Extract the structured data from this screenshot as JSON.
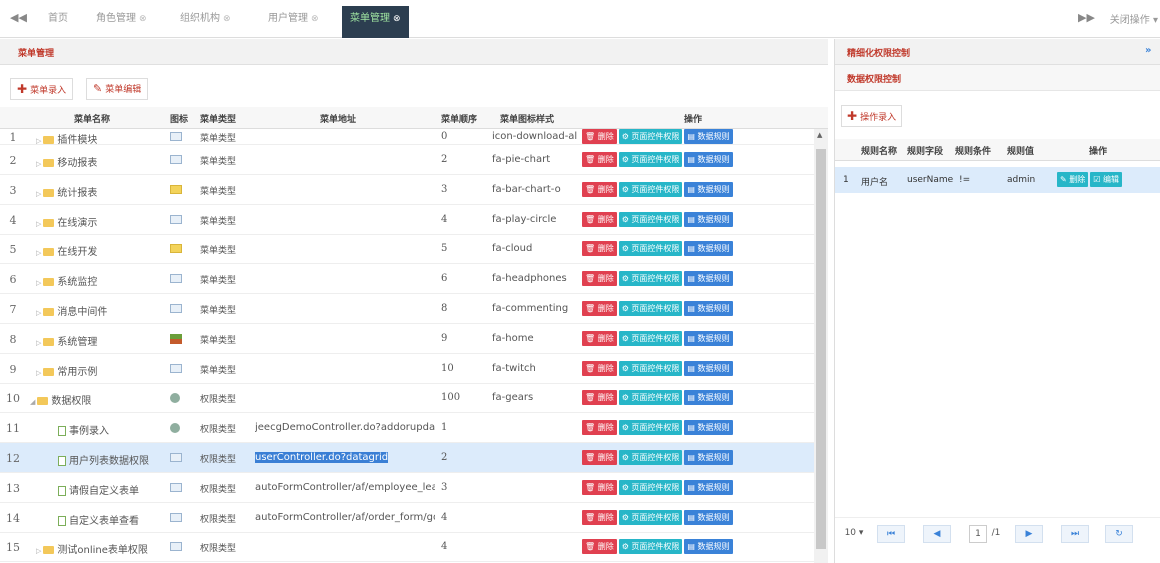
{
  "tabs": {
    "left_arrow": "◀◀",
    "items": [
      {
        "label": "首页",
        "closable": false
      },
      {
        "label": "角色管理",
        "closable": true
      },
      {
        "label": "组织机构",
        "closable": true
      },
      {
        "label": "用户管理",
        "closable": true
      },
      {
        "label": "菜单管理",
        "closable": true,
        "active": true
      }
    ],
    "right_arrow": "▶▶",
    "close_ops": "关闭操作"
  },
  "left_panel": {
    "title": "菜单管理",
    "toolbar": {
      "add_label": "菜单录入",
      "edit_label": "菜单编辑"
    },
    "columns": [
      "菜单名称",
      "图标",
      "菜单类型",
      "菜单地址",
      "菜单顺序",
      "菜单图标样式",
      "操作"
    ],
    "ops": {
      "delete": "删除",
      "page_perm": "页面控件权限",
      "data_rule": "数据规则"
    },
    "rows": [
      {
        "n": "1",
        "name": "插件模块",
        "kind": "folder",
        "icon": "box",
        "type": "菜单类型",
        "url": "",
        "order": "0",
        "style": "icon-download-alt"
      },
      {
        "n": "2",
        "name": "移动报表",
        "kind": "folder",
        "icon": "box",
        "type": "菜单类型",
        "url": "",
        "order": "2",
        "style": "fa-pie-chart"
      },
      {
        "n": "3",
        "name": "统计报表",
        "kind": "folder",
        "icon": "yel",
        "type": "菜单类型",
        "url": "",
        "order": "3",
        "style": "fa-bar-chart-o"
      },
      {
        "n": "4",
        "name": "在线演示",
        "kind": "folder",
        "icon": "box",
        "type": "菜单类型",
        "url": "",
        "order": "4",
        "style": "fa-play-circle"
      },
      {
        "n": "5",
        "name": "在线开发",
        "kind": "folder",
        "icon": "yel",
        "type": "菜单类型",
        "url": "",
        "order": "5",
        "style": "fa-cloud"
      },
      {
        "n": "6",
        "name": "系统监控",
        "kind": "folder",
        "icon": "box",
        "type": "菜单类型",
        "url": "",
        "order": "6",
        "style": "fa-headphones"
      },
      {
        "n": "7",
        "name": "消息中间件",
        "kind": "folder",
        "icon": "box",
        "type": "菜单类型",
        "url": "",
        "order": "8",
        "style": "fa-commenting"
      },
      {
        "n": "8",
        "name": "系统管理",
        "kind": "folder",
        "icon": "house",
        "type": "菜单类型",
        "url": "",
        "order": "9",
        "style": "fa-home"
      },
      {
        "n": "9",
        "name": "常用示例",
        "kind": "folder",
        "icon": "box",
        "type": "菜单类型",
        "url": "",
        "order": "10",
        "style": "fa-twitch"
      },
      {
        "n": "10",
        "name": "数据权限",
        "kind": "folder-open",
        "icon": "gear",
        "type": "权限类型",
        "url": "",
        "order": "100",
        "style": "fa-gears"
      },
      {
        "n": "11",
        "name": "事例录入",
        "kind": "doc",
        "icon": "gear",
        "type": "权限类型",
        "url": "jeecgDemoController.do?addorupdate",
        "order": "1",
        "style": ""
      },
      {
        "n": "12",
        "name": "用户列表数据权限",
        "kind": "doc",
        "icon": "box",
        "type": "权限类型",
        "url": "userController.do?datagrid",
        "order": "2",
        "style": "",
        "selected": true
      },
      {
        "n": "13",
        "name": "请假自定义表单",
        "kind": "doc",
        "icon": "box",
        "type": "权限类型",
        "url": "autoFormController/af/employee_leave_f",
        "order": "3",
        "style": ""
      },
      {
        "n": "14",
        "name": "自定义表单查看",
        "kind": "doc",
        "icon": "box",
        "type": "权限类型",
        "url": "autoFormController/af/order_form/goUp",
        "order": "4",
        "style": ""
      },
      {
        "n": "15",
        "name": "测试online表单权限",
        "kind": "folder",
        "icon": "box",
        "type": "权限类型",
        "url": "",
        "order": "4",
        "style": ""
      }
    ]
  },
  "right_panel": {
    "title": "精细化权限控制",
    "subtitle": "数据权限控制",
    "add_label": "操作录入",
    "columns": [
      "规则名称",
      "规则字段",
      "规则条件",
      "规则值",
      "操作"
    ],
    "rows": [
      {
        "n": "1",
        "name": "用户名",
        "field": "userName",
        "cond": "!=",
        "value": "admin",
        "del": "删除",
        "edit": "编辑"
      }
    ],
    "pager": {
      "page_size": "10",
      "page": "1",
      "total_pages": "/1"
    }
  }
}
